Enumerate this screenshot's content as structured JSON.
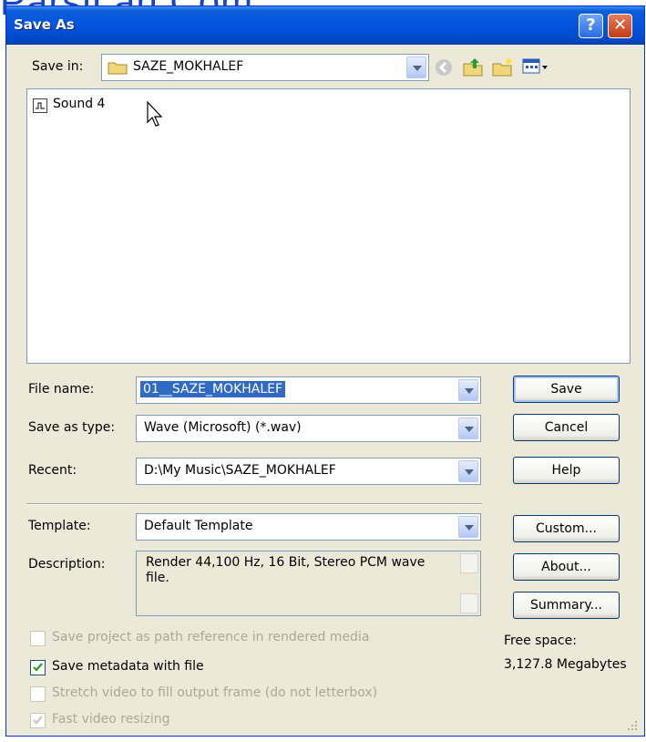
{
  "watermark": "ParsiLan.Com",
  "window": {
    "title": "Save As"
  },
  "title_buttons": {
    "help": "?",
    "close": "✕"
  },
  "save_in": {
    "label": "Save in:",
    "value": "SAZE_MOKHALEF"
  },
  "toolbar_icons": [
    "back-icon",
    "up-folder-icon",
    "new-folder-icon",
    "view-menu-icon"
  ],
  "files": [
    {
      "name": "Sound 4",
      "icon": "audio-file-icon"
    }
  ],
  "fields": {
    "file_name": {
      "label": "File name:",
      "value": "01__SAZE_MOKHALEF"
    },
    "save_as_type": {
      "label": "Save as type:",
      "value": "Wave (Microsoft) (*.wav)"
    },
    "recent": {
      "label": "Recent:",
      "value": "D:\\My Music\\SAZE_MOKHALEF"
    },
    "template": {
      "label": "Template:",
      "value": "Default Template"
    },
    "description": {
      "label": "Description:",
      "value": "Render 44,100 Hz, 16 Bit, Stereo PCM wave file."
    }
  },
  "buttons": {
    "save": "Save",
    "cancel": "Cancel",
    "help": "Help",
    "custom": "Custom...",
    "about": "About...",
    "summary": "Summary..."
  },
  "options": [
    {
      "label": "Save project as path reference in rendered media",
      "checked": false,
      "enabled": false
    },
    {
      "label": "Save metadata with file",
      "checked": true,
      "enabled": true
    },
    {
      "label": "Stretch video to fill output frame (do not letterbox)",
      "checked": false,
      "enabled": false
    },
    {
      "label": "Fast video resizing",
      "checked": true,
      "enabled": false
    }
  ],
  "free_space": {
    "label": "Free space:",
    "value": "3,127.8 Megabytes"
  }
}
